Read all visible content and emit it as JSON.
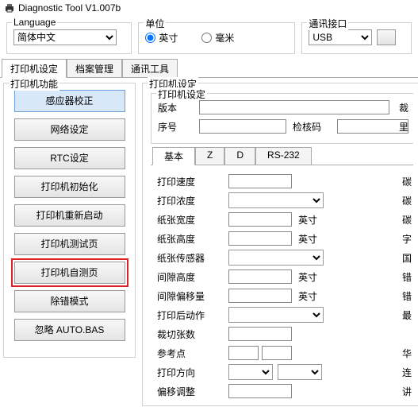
{
  "title": "Diagnostic Tool V1.007b",
  "groups": {
    "language": {
      "legend": "Language",
      "selected": "简体中文"
    },
    "unit": {
      "legend": "单位",
      "inch": "英寸",
      "mm": "毫米",
      "selected": "inch"
    },
    "comm": {
      "legend": "通讯接口",
      "selected": "USB"
    }
  },
  "main_tabs": [
    "打印机设定",
    "档案管理",
    "通讯工具"
  ],
  "left": {
    "legend": "打印机功能",
    "buttons": [
      "感应器校正",
      "网络设定",
      "RTC设定",
      "打印机初始化",
      "打印机重新启动",
      "打印机测试页",
      "打印机自测页",
      "除错模式",
      "忽略 AUTO.BAS"
    ]
  },
  "right": {
    "legend_outer": "打印机设定",
    "legend_inner": "打印机设定",
    "version_label": "版本",
    "serial_label": "序号",
    "check_label": "检核码",
    "edge1": "裁",
    "edge2": "里",
    "sub_tabs": [
      "基本",
      "Z",
      "D",
      "RS-232"
    ],
    "params": {
      "speed": {
        "label": "打印速度",
        "unit": "",
        "edge": "碳"
      },
      "density": {
        "label": "打印浓度",
        "unit": "",
        "edge": "碳"
      },
      "width": {
        "label": "纸张宽度",
        "unit": "英寸",
        "edge": "碳"
      },
      "height": {
        "label": "纸张高度",
        "unit": "英寸",
        "edge": "字"
      },
      "sensor": {
        "label": "纸张传感器",
        "unit": "",
        "edge": "国"
      },
      "gap": {
        "label": "间隙高度",
        "unit": "英寸",
        "edge": "错"
      },
      "gapoffset": {
        "label": "间隙偏移量",
        "unit": "英寸",
        "edge": "错"
      },
      "postact": {
        "label": "打印后动作",
        "unit": "",
        "edge": "最"
      },
      "cut": {
        "label": "裁切张数",
        "unit": "",
        "edge": ""
      },
      "ref": {
        "label": "参考点",
        "unit": "",
        "edge": "华"
      },
      "dir": {
        "label": "打印方向",
        "unit": "",
        "edge": "连"
      },
      "shift": {
        "label": "偏移调整",
        "unit": "",
        "edge": "讲"
      }
    }
  }
}
